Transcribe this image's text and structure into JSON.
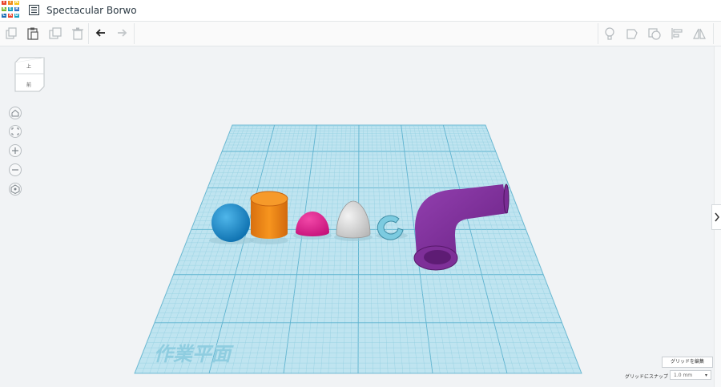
{
  "app": {
    "logo_letters": [
      "T",
      "I",
      "N",
      "K",
      "E",
      "R",
      "C",
      "A",
      "D"
    ],
    "logo_colors": [
      "#e8452c",
      "#f08b1d",
      "#f6c216",
      "#77b82a",
      "#1ba1c1",
      "#2e6fc2",
      "#1e6fb6",
      "#e8452c",
      "#1ba1c1"
    ],
    "document_title": "Spectacular Borwo"
  },
  "toolbar": {
    "left_buttons": [
      "copy-icon",
      "paste-icon",
      "duplicate-icon",
      "trash-icon",
      "undo-icon",
      "redo-icon"
    ],
    "right_buttons": [
      "lightbulb-icon",
      "shape-note-icon",
      "shape-group-icon",
      "align-icon",
      "mirror-icon"
    ]
  },
  "viewcube": {
    "top_label": "上",
    "front_label": "前"
  },
  "nav": [
    "home-icon",
    "fit-view-icon",
    "zoom-in-icon",
    "zoom-out-icon",
    "perspective-icon"
  ],
  "workplane": {
    "label": "作業平面",
    "grid_color": "#7fc6dc",
    "fill_color": "#b9e2ef"
  },
  "shapes": [
    {
      "name": "sphere",
      "color": "#1a8fd1"
    },
    {
      "name": "cylinder",
      "color": "#f08518"
    },
    {
      "name": "half-sphere",
      "color": "#e0168d"
    },
    {
      "name": "paraboloid",
      "color": "#d9d9d9"
    },
    {
      "name": "torus",
      "color": "#79c6d9"
    },
    {
      "name": "tube-elbow",
      "color": "#7b2c96"
    }
  ],
  "grid_controls": {
    "edit_grid_label": "グリッドを編集",
    "snap_label": "グリッドにスナップ",
    "snap_value": "1.0 mm"
  }
}
